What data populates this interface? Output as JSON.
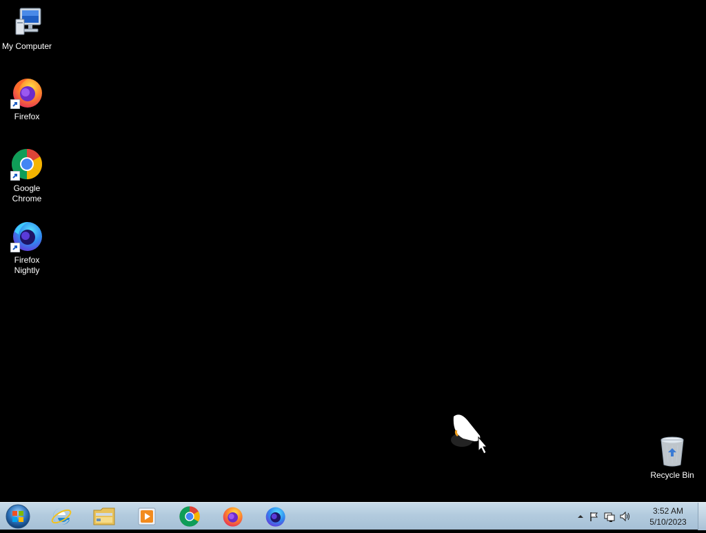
{
  "desktop": {
    "icons": [
      {
        "label": "My Computer",
        "icon": "computer-icon"
      },
      {
        "label": "Firefox",
        "icon": "firefox-icon"
      },
      {
        "label": "Google Chrome",
        "icon": "chrome-icon"
      },
      {
        "label": "Firefox Nightly",
        "icon": "firefox-nightly-icon"
      },
      {
        "label": "Recycle Bin",
        "icon": "recycle-bin-icon"
      }
    ]
  },
  "taskbar": {
    "pinned": [
      {
        "name": "Internet Explorer",
        "icon": "internet-explorer-icon"
      },
      {
        "name": "Windows Explorer",
        "icon": "folder-icon"
      },
      {
        "name": "Windows Media Player",
        "icon": "media-player-icon"
      },
      {
        "name": "Google Chrome",
        "icon": "chrome-icon"
      },
      {
        "name": "Firefox",
        "icon": "firefox-icon"
      },
      {
        "name": "Firefox Nightly",
        "icon": "firefox-nightly-icon"
      }
    ],
    "tray": {
      "time": "3:52 AM",
      "date": "5/10/2023"
    }
  },
  "colors": {
    "desktop_background": "#000000",
    "taskbar": "#b3cbde",
    "label_text": "#ffffff"
  }
}
